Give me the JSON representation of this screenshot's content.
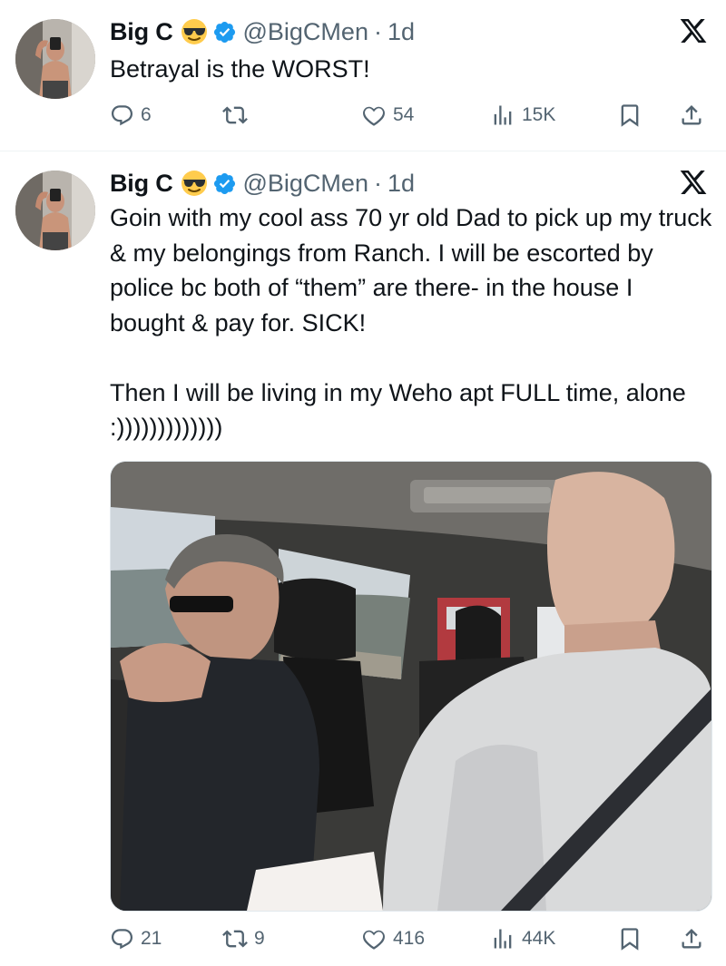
{
  "tweets": [
    {
      "display_name": "Big C",
      "emoji": "😎",
      "handle": "@BigCMen",
      "separator": "·",
      "age": "1d",
      "text": "Betrayal is the WORST!",
      "stats": {
        "replies": "6",
        "reposts": "",
        "likes": "54",
        "views": "15K"
      }
    },
    {
      "display_name": "Big C",
      "emoji": "😎",
      "handle": "@BigCMen",
      "separator": "·",
      "age": "1d",
      "text": "Goin with my cool ass 70 yr old Dad to pick up my truck & my belongings from Ranch.  I will be escorted by police bc both of “them” are there- in the house I bought & pay for.  SICK!\n\nThen I will be living in my Weho apt FULL time, alone :)))))))))))))",
      "stats": {
        "replies": "21",
        "reposts": "9",
        "likes": "416",
        "views": "44K"
      }
    }
  ],
  "icons": {
    "verified": "verified-badge-icon",
    "platform": "x-logo-icon",
    "reply": "reply-icon",
    "repost": "repost-icon",
    "like": "heart-icon",
    "views": "views-icon",
    "bookmark": "bookmark-icon",
    "share": "share-icon"
  },
  "colors": {
    "verified": "#1d9bf0",
    "text": "#0f1419",
    "secondary": "#536471",
    "divider": "#eff3f4"
  }
}
